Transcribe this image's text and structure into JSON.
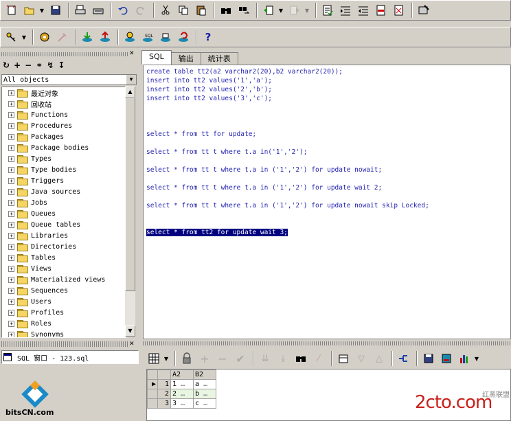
{
  "toolbar1": {
    "icons": [
      "new-icon",
      "open-icon",
      "save-icon",
      "print-icon",
      "print-setup-icon",
      "undo-icon",
      "redo-icon",
      "cut-icon",
      "copy-icon",
      "paste-icon",
      "find-icon",
      "replace-icon",
      "back-icon",
      "forward-icon",
      "compile-icon",
      "indent-icon",
      "unindent-icon",
      "comment-icon",
      "uncomment-icon",
      "tools-icon"
    ]
  },
  "toolbar2": {
    "icons": [
      "key-icon",
      "gear-icon",
      "tool-icon",
      "execute-icon",
      "break-icon",
      "commit-icon",
      "sql-icon",
      "rollback-icon",
      "refresh-icon",
      "help-icon"
    ],
    "help_label": "?",
    "sql_label": "SQL"
  },
  "left": {
    "object_filter": "All objects",
    "tree": [
      "最近对象",
      "回收站",
      "Functions",
      "Procedures",
      "Packages",
      "Package bodies",
      "Types",
      "Type bodies",
      "Triggers",
      "Java sources",
      "Jobs",
      "Queues",
      "Queue tables",
      "Libraries",
      "Directories",
      "Tables",
      "Views",
      "Materialized views",
      "Sequences",
      "Users",
      "Profiles",
      "Roles",
      "Synonyms"
    ],
    "window_label": "SQL 窗口 - 123.sql"
  },
  "tabs": [
    {
      "label": "SQL"
    },
    {
      "label": "输出"
    },
    {
      "label": "统计表"
    }
  ],
  "editor": {
    "lines": [
      "create table tt2(a2 varchar2(20),b2 varchar2(20));",
      "insert into tt2 values('1','a');",
      "insert into tt2 values('2','b');",
      "insert into tt2 values('3','c');",
      "select * from tt for update;",
      "select * from tt t where t.a in('1','2');",
      "select * from tt t where t.a in ('1','2') for update nowait;",
      "select * from tt t where t.a in ('1','2') for update wait 2;",
      "select * from tt t where t.a in ('1','2') for update nowait skip Locked;",
      "select * from tt2 for update wait 3;"
    ]
  },
  "grid": {
    "columns": [
      "A2",
      "B2"
    ],
    "rows": [
      {
        "num": "1",
        "a2": "1",
        "b2": "a"
      },
      {
        "num": "2",
        "a2": "2",
        "b2": "b"
      },
      {
        "num": "3",
        "a2": "3",
        "b2": "c"
      }
    ],
    "ellipsis": "…"
  },
  "watermarks": {
    "left": "bitsCN.com",
    "right": "2cto.com",
    "right_small": "红黑联盟"
  }
}
